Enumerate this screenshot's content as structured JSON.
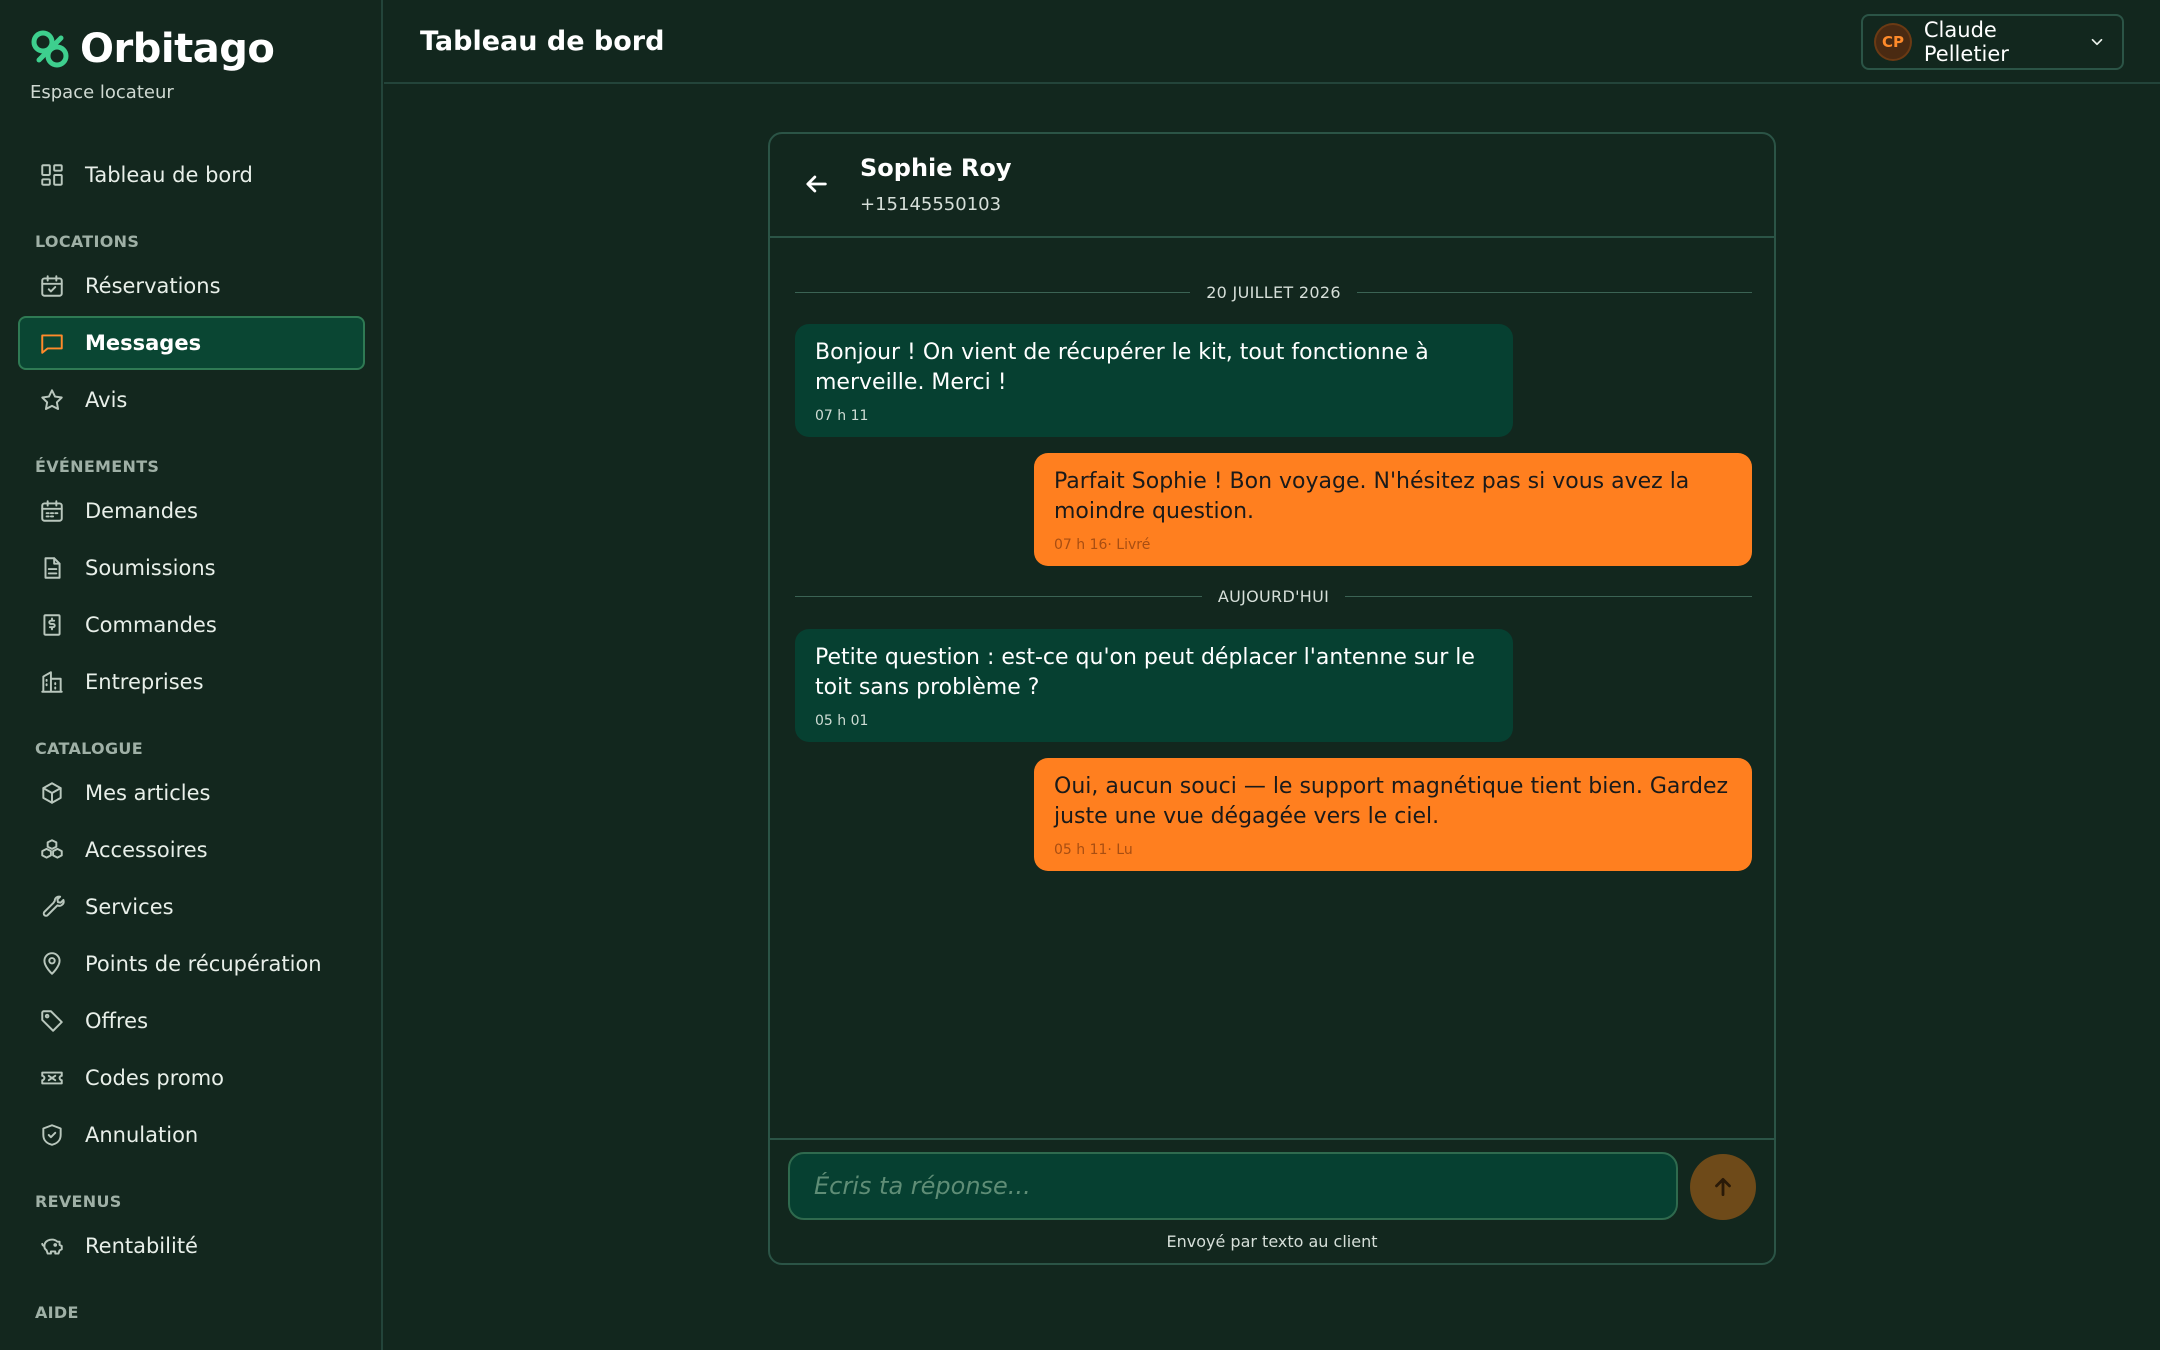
{
  "brand": {
    "name": "Orbitago",
    "subtitle": "Espace locateur",
    "accent": "#ff8a2a",
    "logo_color": "#3ecf8e"
  },
  "sidebar": {
    "dashboard": {
      "label": "Tableau de bord",
      "icon": "dashboard-icon"
    },
    "sections": [
      {
        "title": "LOCATIONS",
        "items": [
          {
            "label": "Réservations",
            "icon": "calendar-check-icon"
          },
          {
            "label": "Messages",
            "icon": "message-icon",
            "active": true
          },
          {
            "label": "Avis",
            "icon": "star-icon"
          }
        ]
      },
      {
        "title": "ÉVÉNEMENTS",
        "items": [
          {
            "label": "Demandes",
            "icon": "calendar-list-icon"
          },
          {
            "label": "Soumissions",
            "icon": "document-icon"
          },
          {
            "label": "Commandes",
            "icon": "receipt-dollar-icon"
          },
          {
            "label": "Entreprises",
            "icon": "building-icon"
          }
        ]
      },
      {
        "title": "CATALOGUE",
        "items": [
          {
            "label": "Mes articles",
            "icon": "box-icon"
          },
          {
            "label": "Accessoires",
            "icon": "boxes-icon"
          },
          {
            "label": "Services",
            "icon": "wrench-icon"
          },
          {
            "label": "Points de récupération",
            "icon": "map-pin-icon"
          },
          {
            "label": "Offres",
            "icon": "tag-icon"
          },
          {
            "label": "Codes promo",
            "icon": "ticket-icon"
          },
          {
            "label": "Annulation",
            "icon": "shield-check-icon"
          }
        ]
      },
      {
        "title": "REVENUS",
        "items": [
          {
            "label": "Rentabilité",
            "icon": "piggy-bank-icon"
          }
        ]
      },
      {
        "title": "AIDE",
        "items": []
      }
    ]
  },
  "header": {
    "title": "Tableau de bord",
    "user": {
      "initials": "CP",
      "name": "Claude Pelletier"
    }
  },
  "chat": {
    "contact": {
      "name": "Sophie Roy",
      "phone": "+15145550103"
    },
    "groups": [
      {
        "label": "20 JUILLET 2026",
        "messages": [
          {
            "direction": "in",
            "text": "Bonjour ! On vient de récupérer le kit, tout fonctionne à merveille. Merci !",
            "meta": "07 h 11"
          },
          {
            "direction": "out",
            "text": "Parfait Sophie ! Bon voyage. N'hésitez pas si vous avez la moindre question.",
            "meta": "07 h 16· Livré"
          }
        ]
      },
      {
        "label": "AUJOURD'HUI",
        "messages": [
          {
            "direction": "in",
            "text": "Petite question : est-ce qu'on peut déplacer l'antenne sur le toit sans problème ?",
            "meta": "05 h 01"
          },
          {
            "direction": "out",
            "text": "Oui, aucun souci — le support magnétique tient bien. Gardez juste une vue dégagée vers le ciel.",
            "meta": "05 h 11· Lu"
          }
        ]
      }
    ],
    "composer": {
      "placeholder": "Écris ta réponse...",
      "note": "Envoyé par texto au client"
    }
  }
}
